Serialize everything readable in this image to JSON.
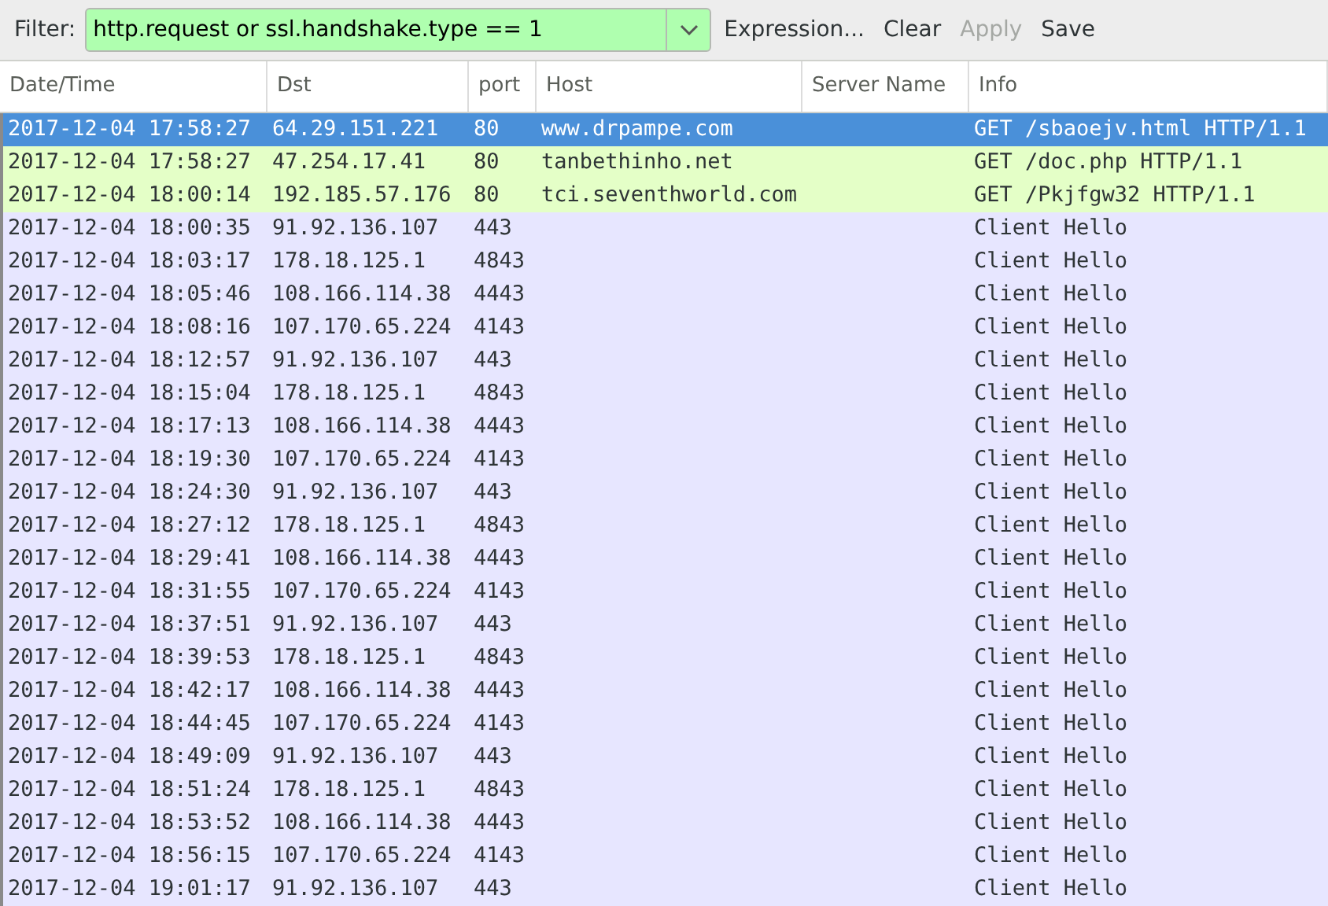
{
  "filter_bar": {
    "label": "Filter:",
    "value": "http.request or ssl.handshake.type == 1",
    "valid": true,
    "buttons": [
      {
        "label": "Expression...",
        "disabled": false
      },
      {
        "label": "Clear",
        "disabled": false
      },
      {
        "label": "Apply",
        "disabled": true
      },
      {
        "label": "Save",
        "disabled": false
      }
    ]
  },
  "table": {
    "columns": [
      "Date/Time",
      "Dst",
      "port",
      "Host",
      "Server Name",
      "Info"
    ],
    "rows": [
      {
        "cells": [
          "2017-12-04 17:58:27",
          "64.29.151.221",
          "80",
          "www.drpampe.com",
          "",
          "GET /sbaoejv.html HTTP/1.1"
        ],
        "selected": true
      },
      {
        "cells": [
          "2017-12-04 17:58:27",
          "47.254.17.41",
          "80",
          "tanbethinho.net",
          "",
          "GET /doc.php HTTP/1.1"
        ],
        "selected": false,
        "color": "#e4ffc7"
      },
      {
        "cells": [
          "2017-12-04 18:00:14",
          "192.185.57.176",
          "80",
          "tci.seventhworld.com",
          "",
          "GET /Pkjfgw32 HTTP/1.1"
        ],
        "selected": false,
        "color": "#e4ffc7"
      },
      {
        "cells": [
          "2017-12-04 18:00:35",
          "91.92.136.107",
          "443",
          "",
          "",
          "Client Hello"
        ],
        "selected": false,
        "color": "#e7e6ff"
      },
      {
        "cells": [
          "2017-12-04 18:03:17",
          "178.18.125.1",
          "4843",
          "",
          "",
          "Client Hello"
        ],
        "selected": false,
        "color": "#e7e6ff"
      },
      {
        "cells": [
          "2017-12-04 18:05:46",
          "108.166.114.38",
          "4443",
          "",
          "",
          "Client Hello"
        ],
        "selected": false,
        "color": "#e7e6ff"
      },
      {
        "cells": [
          "2017-12-04 18:08:16",
          "107.170.65.224",
          "4143",
          "",
          "",
          "Client Hello"
        ],
        "selected": false,
        "color": "#e7e6ff"
      },
      {
        "cells": [
          "2017-12-04 18:12:57",
          "91.92.136.107",
          "443",
          "",
          "",
          "Client Hello"
        ],
        "selected": false,
        "color": "#e7e6ff"
      },
      {
        "cells": [
          "2017-12-04 18:15:04",
          "178.18.125.1",
          "4843",
          "",
          "",
          "Client Hello"
        ],
        "selected": false,
        "color": "#e7e6ff"
      },
      {
        "cells": [
          "2017-12-04 18:17:13",
          "108.166.114.38",
          "4443",
          "",
          "",
          "Client Hello"
        ],
        "selected": false,
        "color": "#e7e6ff"
      },
      {
        "cells": [
          "2017-12-04 18:19:30",
          "107.170.65.224",
          "4143",
          "",
          "",
          "Client Hello"
        ],
        "selected": false,
        "color": "#e7e6ff"
      },
      {
        "cells": [
          "2017-12-04 18:24:30",
          "91.92.136.107",
          "443",
          "",
          "",
          "Client Hello"
        ],
        "selected": false,
        "color": "#e7e6ff"
      },
      {
        "cells": [
          "2017-12-04 18:27:12",
          "178.18.125.1",
          "4843",
          "",
          "",
          "Client Hello"
        ],
        "selected": false,
        "color": "#e7e6ff"
      },
      {
        "cells": [
          "2017-12-04 18:29:41",
          "108.166.114.38",
          "4443",
          "",
          "",
          "Client Hello"
        ],
        "selected": false,
        "color": "#e7e6ff"
      },
      {
        "cells": [
          "2017-12-04 18:31:55",
          "107.170.65.224",
          "4143",
          "",
          "",
          "Client Hello"
        ],
        "selected": false,
        "color": "#e7e6ff"
      },
      {
        "cells": [
          "2017-12-04 18:37:51",
          "91.92.136.107",
          "443",
          "",
          "",
          "Client Hello"
        ],
        "selected": false,
        "color": "#e7e6ff"
      },
      {
        "cells": [
          "2017-12-04 18:39:53",
          "178.18.125.1",
          "4843",
          "",
          "",
          "Client Hello"
        ],
        "selected": false,
        "color": "#e7e6ff"
      },
      {
        "cells": [
          "2017-12-04 18:42:17",
          "108.166.114.38",
          "4443",
          "",
          "",
          "Client Hello"
        ],
        "selected": false,
        "color": "#e7e6ff"
      },
      {
        "cells": [
          "2017-12-04 18:44:45",
          "107.170.65.224",
          "4143",
          "",
          "",
          "Client Hello"
        ],
        "selected": false,
        "color": "#e7e6ff"
      },
      {
        "cells": [
          "2017-12-04 18:49:09",
          "91.92.136.107",
          "443",
          "",
          "",
          "Client Hello"
        ],
        "selected": false,
        "color": "#e7e6ff"
      },
      {
        "cells": [
          "2017-12-04 18:51:24",
          "178.18.125.1",
          "4843",
          "",
          "",
          "Client Hello"
        ],
        "selected": false,
        "color": "#e7e6ff"
      },
      {
        "cells": [
          "2017-12-04 18:53:52",
          "108.166.114.38",
          "4443",
          "",
          "",
          "Client Hello"
        ],
        "selected": false,
        "color": "#e7e6ff"
      },
      {
        "cells": [
          "2017-12-04 18:56:15",
          "107.170.65.224",
          "4143",
          "",
          "",
          "Client Hello"
        ],
        "selected": false,
        "color": "#e7e6ff"
      },
      {
        "cells": [
          "2017-12-04 19:01:17",
          "91.92.136.107",
          "443",
          "",
          "",
          "Client Hello"
        ],
        "selected": false,
        "color": "#e7e6ff"
      }
    ]
  }
}
